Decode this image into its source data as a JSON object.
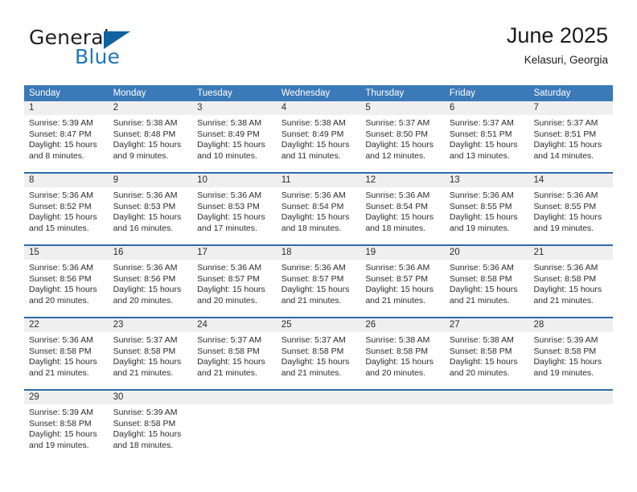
{
  "brand": {
    "name_top": "General",
    "name_bottom": "Blue",
    "mark": "triangle-logo",
    "color_dark": "#231f20",
    "color_blue": "#1f77bd",
    "mark_color": "#10639f"
  },
  "header": {
    "title": "June 2025",
    "subtitle": "Kelasuri, Georgia"
  },
  "theme": {
    "header_bg": "#3b79b8",
    "row_divider": "#2e6aa8",
    "daynum_bg": "#efefef",
    "text": "#2b2b2b"
  },
  "calendar": {
    "weekdays": [
      "Sunday",
      "Monday",
      "Tuesday",
      "Wednesday",
      "Thursday",
      "Friday",
      "Saturday"
    ],
    "weeks": [
      [
        {
          "day": "1",
          "sunrise": "Sunrise: 5:39 AM",
          "sunset": "Sunset: 8:47 PM",
          "daylight1": "Daylight: 15 hours",
          "daylight2": "and 8 minutes."
        },
        {
          "day": "2",
          "sunrise": "Sunrise: 5:38 AM",
          "sunset": "Sunset: 8:48 PM",
          "daylight1": "Daylight: 15 hours",
          "daylight2": "and 9 minutes."
        },
        {
          "day": "3",
          "sunrise": "Sunrise: 5:38 AM",
          "sunset": "Sunset: 8:49 PM",
          "daylight1": "Daylight: 15 hours",
          "daylight2": "and 10 minutes."
        },
        {
          "day": "4",
          "sunrise": "Sunrise: 5:38 AM",
          "sunset": "Sunset: 8:49 PM",
          "daylight1": "Daylight: 15 hours",
          "daylight2": "and 11 minutes."
        },
        {
          "day": "5",
          "sunrise": "Sunrise: 5:37 AM",
          "sunset": "Sunset: 8:50 PM",
          "daylight1": "Daylight: 15 hours",
          "daylight2": "and 12 minutes."
        },
        {
          "day": "6",
          "sunrise": "Sunrise: 5:37 AM",
          "sunset": "Sunset: 8:51 PM",
          "daylight1": "Daylight: 15 hours",
          "daylight2": "and 13 minutes."
        },
        {
          "day": "7",
          "sunrise": "Sunrise: 5:37 AM",
          "sunset": "Sunset: 8:51 PM",
          "daylight1": "Daylight: 15 hours",
          "daylight2": "and 14 minutes."
        }
      ],
      [
        {
          "day": "8",
          "sunrise": "Sunrise: 5:36 AM",
          "sunset": "Sunset: 8:52 PM",
          "daylight1": "Daylight: 15 hours",
          "daylight2": "and 15 minutes."
        },
        {
          "day": "9",
          "sunrise": "Sunrise: 5:36 AM",
          "sunset": "Sunset: 8:53 PM",
          "daylight1": "Daylight: 15 hours",
          "daylight2": "and 16 minutes."
        },
        {
          "day": "10",
          "sunrise": "Sunrise: 5:36 AM",
          "sunset": "Sunset: 8:53 PM",
          "daylight1": "Daylight: 15 hours",
          "daylight2": "and 17 minutes."
        },
        {
          "day": "11",
          "sunrise": "Sunrise: 5:36 AM",
          "sunset": "Sunset: 8:54 PM",
          "daylight1": "Daylight: 15 hours",
          "daylight2": "and 18 minutes."
        },
        {
          "day": "12",
          "sunrise": "Sunrise: 5:36 AM",
          "sunset": "Sunset: 8:54 PM",
          "daylight1": "Daylight: 15 hours",
          "daylight2": "and 18 minutes."
        },
        {
          "day": "13",
          "sunrise": "Sunrise: 5:36 AM",
          "sunset": "Sunset: 8:55 PM",
          "daylight1": "Daylight: 15 hours",
          "daylight2": "and 19 minutes."
        },
        {
          "day": "14",
          "sunrise": "Sunrise: 5:36 AM",
          "sunset": "Sunset: 8:55 PM",
          "daylight1": "Daylight: 15 hours",
          "daylight2": "and 19 minutes."
        }
      ],
      [
        {
          "day": "15",
          "sunrise": "Sunrise: 5:36 AM",
          "sunset": "Sunset: 8:56 PM",
          "daylight1": "Daylight: 15 hours",
          "daylight2": "and 20 minutes."
        },
        {
          "day": "16",
          "sunrise": "Sunrise: 5:36 AM",
          "sunset": "Sunset: 8:56 PM",
          "daylight1": "Daylight: 15 hours",
          "daylight2": "and 20 minutes."
        },
        {
          "day": "17",
          "sunrise": "Sunrise: 5:36 AM",
          "sunset": "Sunset: 8:57 PM",
          "daylight1": "Daylight: 15 hours",
          "daylight2": "and 20 minutes."
        },
        {
          "day": "18",
          "sunrise": "Sunrise: 5:36 AM",
          "sunset": "Sunset: 8:57 PM",
          "daylight1": "Daylight: 15 hours",
          "daylight2": "and 21 minutes."
        },
        {
          "day": "19",
          "sunrise": "Sunrise: 5:36 AM",
          "sunset": "Sunset: 8:57 PM",
          "daylight1": "Daylight: 15 hours",
          "daylight2": "and 21 minutes."
        },
        {
          "day": "20",
          "sunrise": "Sunrise: 5:36 AM",
          "sunset": "Sunset: 8:58 PM",
          "daylight1": "Daylight: 15 hours",
          "daylight2": "and 21 minutes."
        },
        {
          "day": "21",
          "sunrise": "Sunrise: 5:36 AM",
          "sunset": "Sunset: 8:58 PM",
          "daylight1": "Daylight: 15 hours",
          "daylight2": "and 21 minutes."
        }
      ],
      [
        {
          "day": "22",
          "sunrise": "Sunrise: 5:36 AM",
          "sunset": "Sunset: 8:58 PM",
          "daylight1": "Daylight: 15 hours",
          "daylight2": "and 21 minutes."
        },
        {
          "day": "23",
          "sunrise": "Sunrise: 5:37 AM",
          "sunset": "Sunset: 8:58 PM",
          "daylight1": "Daylight: 15 hours",
          "daylight2": "and 21 minutes."
        },
        {
          "day": "24",
          "sunrise": "Sunrise: 5:37 AM",
          "sunset": "Sunset: 8:58 PM",
          "daylight1": "Daylight: 15 hours",
          "daylight2": "and 21 minutes."
        },
        {
          "day": "25",
          "sunrise": "Sunrise: 5:37 AM",
          "sunset": "Sunset: 8:58 PM",
          "daylight1": "Daylight: 15 hours",
          "daylight2": "and 21 minutes."
        },
        {
          "day": "26",
          "sunrise": "Sunrise: 5:38 AM",
          "sunset": "Sunset: 8:58 PM",
          "daylight1": "Daylight: 15 hours",
          "daylight2": "and 20 minutes."
        },
        {
          "day": "27",
          "sunrise": "Sunrise: 5:38 AM",
          "sunset": "Sunset: 8:58 PM",
          "daylight1": "Daylight: 15 hours",
          "daylight2": "and 20 minutes."
        },
        {
          "day": "28",
          "sunrise": "Sunrise: 5:39 AM",
          "sunset": "Sunset: 8:58 PM",
          "daylight1": "Daylight: 15 hours",
          "daylight2": "and 19 minutes."
        }
      ],
      [
        {
          "day": "29",
          "sunrise": "Sunrise: 5:39 AM",
          "sunset": "Sunset: 8:58 PM",
          "daylight1": "Daylight: 15 hours",
          "daylight2": "and 19 minutes."
        },
        {
          "day": "30",
          "sunrise": "Sunrise: 5:39 AM",
          "sunset": "Sunset: 8:58 PM",
          "daylight1": "Daylight: 15 hours",
          "daylight2": "and 18 minutes."
        },
        {
          "day": "",
          "sunrise": "",
          "sunset": "",
          "daylight1": "",
          "daylight2": ""
        },
        {
          "day": "",
          "sunrise": "",
          "sunset": "",
          "daylight1": "",
          "daylight2": ""
        },
        {
          "day": "",
          "sunrise": "",
          "sunset": "",
          "daylight1": "",
          "daylight2": ""
        },
        {
          "day": "",
          "sunrise": "",
          "sunset": "",
          "daylight1": "",
          "daylight2": ""
        },
        {
          "day": "",
          "sunrise": "",
          "sunset": "",
          "daylight1": "",
          "daylight2": ""
        }
      ]
    ]
  }
}
